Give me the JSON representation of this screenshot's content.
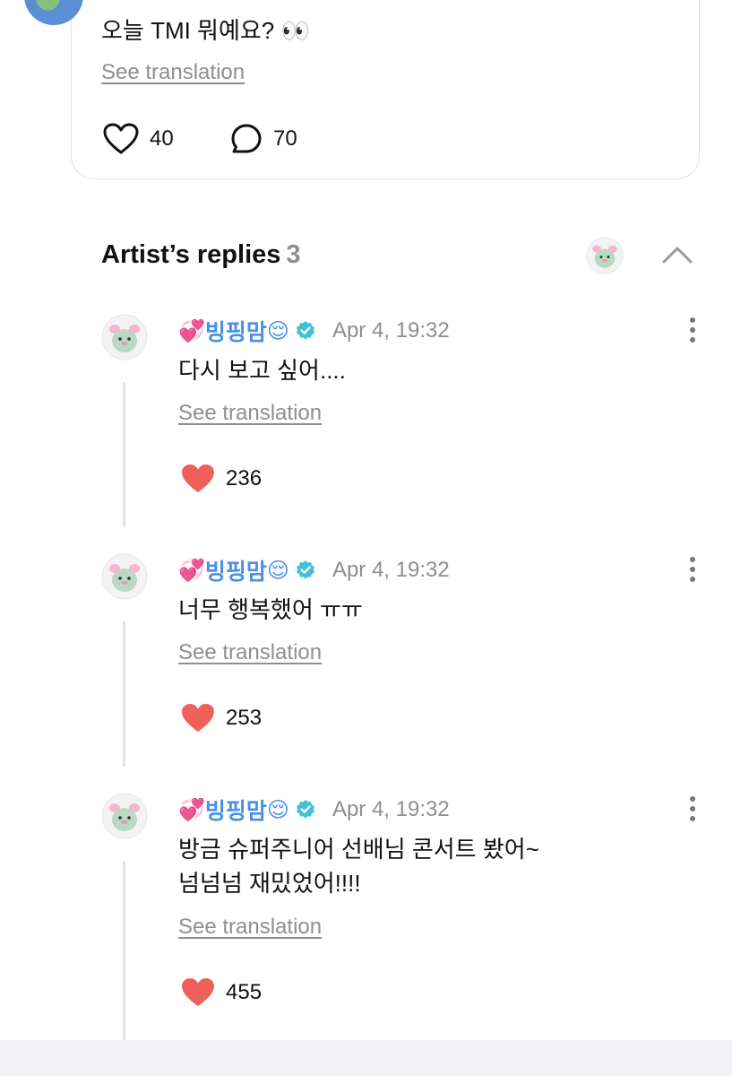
{
  "post": {
    "text": "오늘 TMI 뭐예요? 👀",
    "see_translation": "See translation",
    "likes": "40",
    "comments": "70"
  },
  "artist_replies": {
    "title": "Artist’s replies",
    "count": "3"
  },
  "replies": [
    {
      "name": "빙핑맘",
      "name_prefix_emoji": "💞",
      "name_suffix_emoji": "😌",
      "time": "Apr 4, 19:32",
      "text": "다시 보고 싶어....",
      "see_translation": "See translation",
      "likes": "236"
    },
    {
      "name": "빙핑맘",
      "name_prefix_emoji": "💞",
      "name_suffix_emoji": "😌",
      "time": "Apr 4, 19:32",
      "text": "너무 행복했어 ㅠㅠ",
      "see_translation": "See translation",
      "likes": "253"
    },
    {
      "name": "빙핑맘",
      "name_prefix_emoji": "💞",
      "name_suffix_emoji": "😌",
      "time": "Apr 4, 19:32",
      "text": "방금 슈퍼주니어 선배님 콘서트 봤어~\n넘넘넘 재밌었어!!!!",
      "see_translation": "See translation",
      "likes": "455"
    }
  ],
  "icons": {
    "heart_outline": "heart-outline-icon",
    "comment": "comment-bubble-icon",
    "heart_filled": "heart-filled-icon",
    "verified": "verified-badge-icon",
    "more": "more-vertical-icon",
    "collapse": "chevron-up-icon"
  },
  "colors": {
    "like_red": "#f0605a",
    "name_blue": "#4a8fe8",
    "verified_teal": "#3fc1d6",
    "muted_gray": "#8e8e93"
  }
}
